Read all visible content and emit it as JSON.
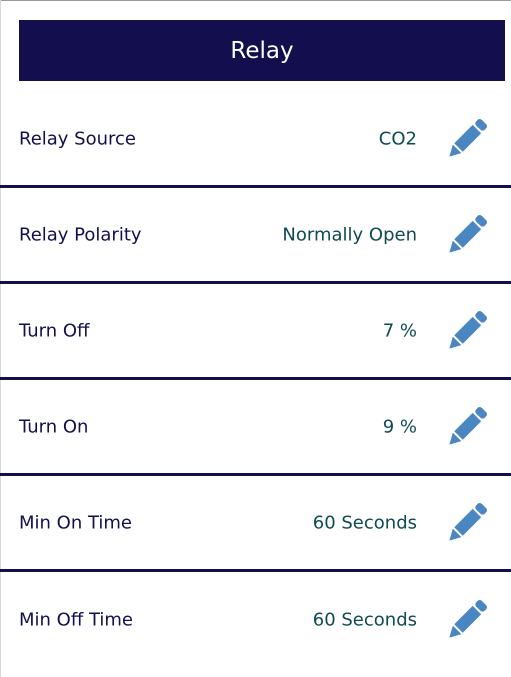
{
  "header": {
    "title": "Relay"
  },
  "rows": [
    {
      "label": "Relay Source",
      "value": "CO2",
      "action_icon": "pencil-icon"
    },
    {
      "label": "Relay Polarity",
      "value": "Normally Open",
      "action_icon": "pencil-icon"
    },
    {
      "label": "Turn Off",
      "value": "7 %",
      "action_icon": "pencil-icon"
    },
    {
      "label": "Turn On",
      "value": "9 %",
      "action_icon": "pencil-icon"
    },
    {
      "label": "Min On Time",
      "value": "60 Seconds",
      "action_icon": "pencil-icon"
    },
    {
      "label": "Min Off Time",
      "value": "60 Seconds",
      "action_icon": "pencil-icon"
    }
  ],
  "colors": {
    "header_bg": "#130f4f",
    "header_text": "#ffffff",
    "label_text": "#130f4f",
    "value_text": "#0f4a52",
    "divider": "#130f4f",
    "icon": "#4a86c2"
  }
}
